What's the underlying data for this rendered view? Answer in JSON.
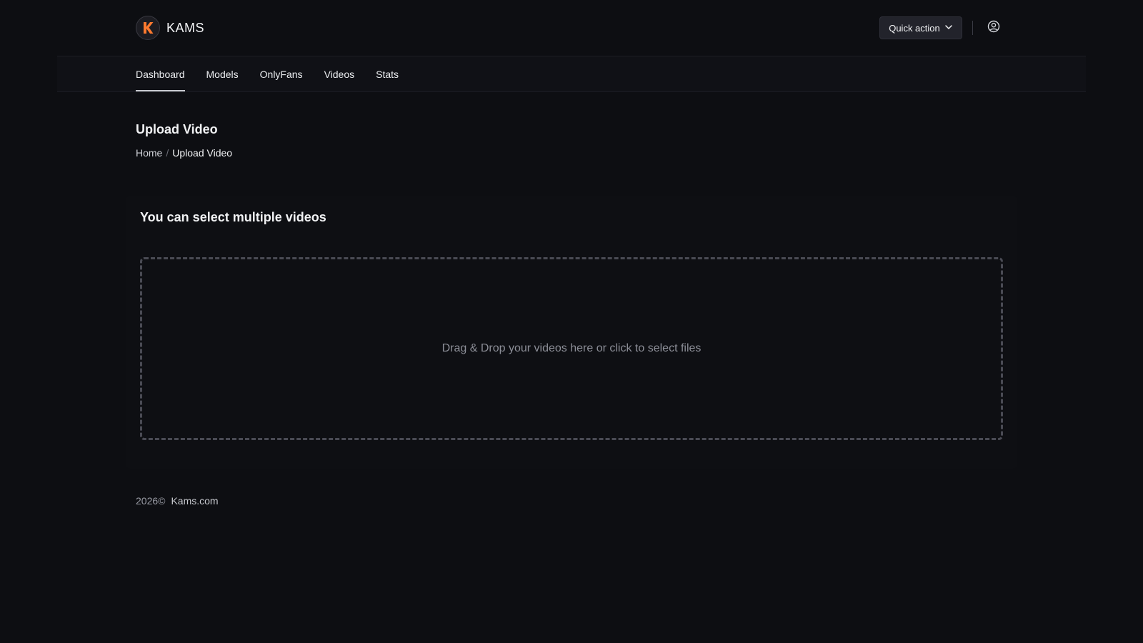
{
  "brand": {
    "letter": "K",
    "name": "KAMS",
    "accent_color": "#ff7a2f"
  },
  "header": {
    "quick_action_label": "Quick action",
    "quick_action_icon": "chevron-down-icon",
    "user_icon": "user-circle-icon"
  },
  "nav": {
    "items": [
      {
        "label": "Dashboard",
        "active": true
      },
      {
        "label": "Models",
        "active": false
      },
      {
        "label": "OnlyFans",
        "active": false
      },
      {
        "label": "Videos",
        "active": false
      },
      {
        "label": "Stats",
        "active": false
      }
    ]
  },
  "page": {
    "title": "Upload Video",
    "breadcrumb": {
      "home": "Home",
      "separator": "/",
      "current": "Upload Video"
    }
  },
  "upload_card": {
    "title": "You can select multiple videos",
    "dropzone_text": "Drag & Drop your videos here or click to select files"
  },
  "footer": {
    "year": "2026©",
    "link": "Kams.com"
  }
}
